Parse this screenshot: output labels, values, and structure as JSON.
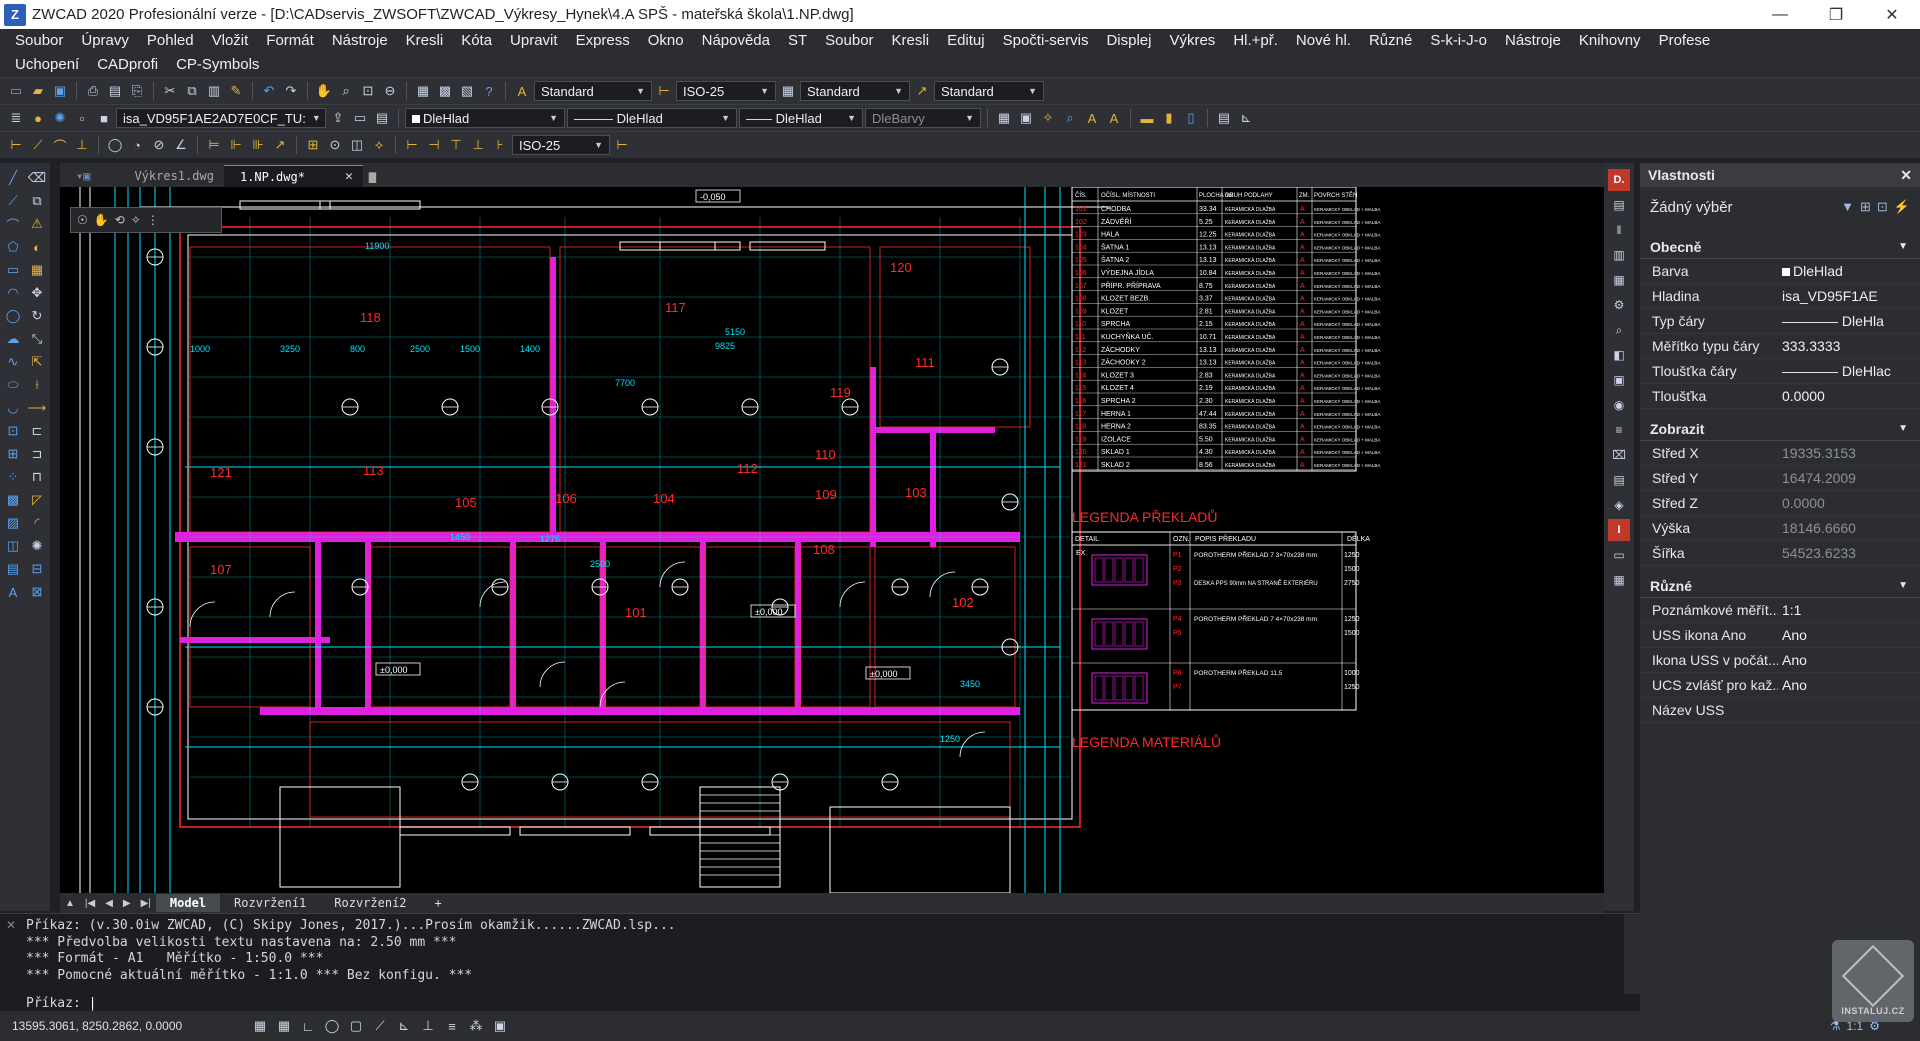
{
  "app": {
    "title": "ZWCAD 2020 Profesionální verze - [D:\\CADservis_ZWSOFT\\ZWCAD_Výkresy_Hynek\\4.A SPŠ - mateřská škola\\1.NP.dwg]",
    "logo_letter": "Z"
  },
  "window_controls": {
    "minimize": "—",
    "restore": "❐",
    "close": "✕"
  },
  "menu": {
    "row1": [
      "Soubor",
      "Úpravy",
      "Pohled",
      "Vložit",
      "Formát",
      "Nástroje",
      "Kresli",
      "Kóta",
      "Upravit",
      "Express",
      "Okno",
      "Nápověda",
      "ST",
      "Soubor",
      "Kresli",
      "Edituj",
      "Spočti-servis",
      "Displej",
      "Výkres",
      "Hl.+př.",
      "Nové hl.",
      "Různé",
      "S-k-i-J-o",
      "Nástroje",
      "Knihovny",
      "Profese"
    ],
    "row2": [
      "Uchopení",
      "CADprofi",
      "CP-Symbols"
    ]
  },
  "toolbar1": {
    "text_style": "Standard",
    "dim_style": "ISO-25",
    "table_style": "Standard",
    "mleader_style": "Standard"
  },
  "toolbar2": {
    "layer": "isa_VD95F1AE2AD7E0CF_TU:",
    "color": "DleHlad",
    "linetype": "DleHlad",
    "lineweight": "DleHlad",
    "plotstyle": "DleBarvy"
  },
  "toolbar3": {
    "dim_style": "ISO-25"
  },
  "doc_tabs": [
    {
      "label": "Výkres1.dwg",
      "active": false
    },
    {
      "label": "1.NP.dwg*",
      "active": true
    }
  ],
  "drawing": {
    "elevation_marks": [
      "-0,050",
      "±0,000",
      "±0,000",
      "±0,000"
    ],
    "room_numbers": [
      "118",
      "117",
      "120",
      "111",
      "119",
      "121",
      "113",
      "105",
      "106",
      "104",
      "112",
      "110",
      "109",
      "103",
      "107",
      "108",
      "101",
      "102"
    ],
    "dims": [
      "11900",
      "5150",
      "9825",
      "7700",
      "1000",
      "3250",
      "800",
      "2500",
      "1500",
      "1400",
      "1450",
      "1275",
      "2500",
      "3450",
      "1250"
    ],
    "room_table": {
      "headers": [
        "ČÍS.",
        "OČÍSL. MÍSTNOSTI",
        "PLOCHA m2",
        "DRUH PODLAHY",
        "ZM.",
        "POVRCH STĚN"
      ],
      "rows": [
        [
          "101",
          "CHODBA",
          "33.34"
        ],
        [
          "102",
          "ZÁDVĚŘÍ",
          "5.25"
        ],
        [
          "103",
          "HALA",
          "12.25"
        ],
        [
          "104",
          "ŠATNA 1",
          "13.13"
        ],
        [
          "105",
          "ŠATNA 2",
          "13.13"
        ],
        [
          "106",
          "VÝDEJNA JÍDLA",
          "10.84"
        ],
        [
          "107",
          "PŘÍPR. PŘÍPRAVA",
          "8.75"
        ],
        [
          "108",
          "KLOZET BEZB.",
          "3.37"
        ],
        [
          "109",
          "KLOZET",
          "2.81"
        ],
        [
          "110",
          "SPRCHA",
          "2.15"
        ],
        [
          "111",
          "KUCHYŇKA UČ.",
          "10.71"
        ],
        [
          "112",
          "ZÁCHODKY",
          "13.13"
        ],
        [
          "113",
          "ZÁCHODKY 2",
          "13.13"
        ],
        [
          "114",
          "KLOZET 3",
          "2.83"
        ],
        [
          "115",
          "KLOZET 4",
          "2.19"
        ],
        [
          "116",
          "SPRCHA 2",
          "2.30"
        ],
        [
          "117",
          "HERNA 1",
          "47.44"
        ],
        [
          "118",
          "HERNA 2",
          "83.35"
        ],
        [
          "119",
          "IZOLACE",
          "5.50"
        ],
        [
          "120",
          "SKLAD 1",
          "4.30"
        ],
        [
          "121",
          "SKLAD 2",
          "8.56"
        ]
      ],
      "floor_text": "KERAMICKÁ DLAŽBA",
      "wall_text": "KERAMICKÝ OBKLAD + MALBA"
    },
    "legend_lintels": {
      "title": "LEGENDA PŘEKLADŮ",
      "headers": [
        "DETAIL",
        "OZN.",
        "POPIS PŘEKLADU",
        "DÉLKA"
      ],
      "rows": [
        {
          "marks": [
            "P1",
            "P2",
            "P3"
          ],
          "desc": "POROTHERM PŘEKLAD 7 3×70x238 mm",
          "note": "DESKA PPS 90mm NA STRANĚ EXTERIÉRU",
          "lengths": [
            "1250",
            "1500",
            "2750"
          ]
        },
        {
          "marks": [
            "P4",
            "P5"
          ],
          "desc": "POROTHERM PŘEKLAD 7 4×70x238 mm",
          "lengths": [
            "1250",
            "1500"
          ]
        },
        {
          "marks": [
            "P6",
            "P7"
          ],
          "desc": "POROTHERM PŘEKLAD 11,5",
          "lengths": [
            "1000",
            "1250"
          ]
        }
      ],
      "detail_label": "EX"
    },
    "legend_materials": {
      "title": "LEGENDA MATERIÁLŮ"
    }
  },
  "layout_tabs": [
    "Model",
    "Rozvržení1",
    "Rozvržení2",
    "+"
  ],
  "properties": {
    "title": "Vlastnosti",
    "selection": "Žádný výběr",
    "groups": [
      {
        "name": "Obecně",
        "rows": [
          {
            "k": "Barva",
            "v": "DleHlad",
            "swatch": true
          },
          {
            "k": "Hladina",
            "v": "isa_VD95F1AE"
          },
          {
            "k": "Typ čáry",
            "v": "———— DleHla"
          },
          {
            "k": "Měřítko typu čáry",
            "v": "333.3333"
          },
          {
            "k": "Tloušťka čáry",
            "v": "———— DleHlac"
          },
          {
            "k": "Tloušťka",
            "v": "0.0000"
          }
        ]
      },
      {
        "name": "Zobrazit",
        "rows": [
          {
            "k": "Střed X",
            "v": "19335.3153",
            "ro": true
          },
          {
            "k": "Střed Y",
            "v": "16474.2009",
            "ro": true
          },
          {
            "k": "Střed Z",
            "v": "0.0000",
            "ro": true
          },
          {
            "k": "Výška",
            "v": "18146.6660",
            "ro": true
          },
          {
            "k": "Šířka",
            "v": "54523.6233",
            "ro": true
          }
        ]
      },
      {
        "name": "Různé",
        "rows": [
          {
            "k": "Poznámkové měřít...",
            "v": "1:1"
          },
          {
            "k": "USS ikona Ano",
            "v": "Ano"
          },
          {
            "k": "Ikona USS v počát...",
            "v": "Ano"
          },
          {
            "k": "UCS zvlášť pro kaž...",
            "v": "Ano"
          },
          {
            "k": "Název USS",
            "v": ""
          }
        ]
      }
    ]
  },
  "command": {
    "history": [
      "Příkaz: (v.30.0iw ZWCAD, (C) Skipy Jones, 2017.)...Prosím okamžik......ZWCAD.lsp...",
      "*** Předvolba velikosti textu nastavena na: 2.50 mm ***",
      "*** Formát - A1   Měřítko - 1:50.0 ***",
      "*** Pomocné aktuální měřítko - 1:1.0 *** Bez konfigu. ***"
    ],
    "prompt": "Příkaz:"
  },
  "status": {
    "coords": "13595.3061, 8250.2862, 0.0000",
    "scale": "1:1"
  },
  "watermark": {
    "text": "INSTALUJ.CZ"
  },
  "colors": {
    "background": "#000000",
    "cyan": "#00e5ff",
    "red": "#ff2a2a",
    "magenta": "#e020e0",
    "white": "#ffffff"
  }
}
